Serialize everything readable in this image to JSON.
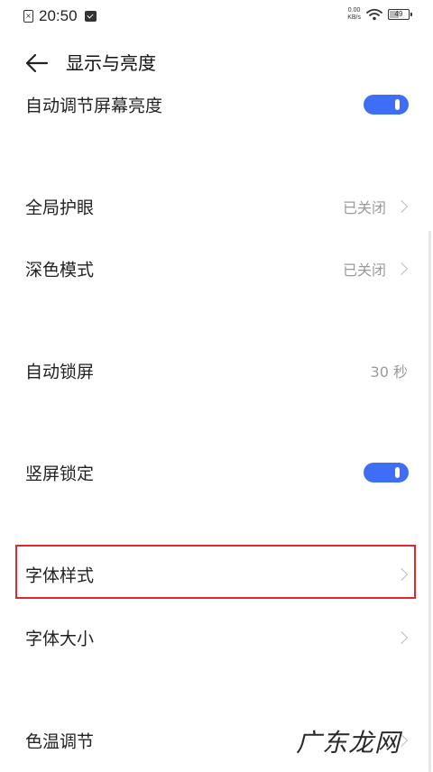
{
  "status_bar": {
    "time": "20:50",
    "net_speed_value": "0.00",
    "net_speed_unit": "KB/s",
    "battery": "49"
  },
  "header": {
    "title": "显示与亮度"
  },
  "settings": {
    "auto_brightness": {
      "label": "自动调节屏幕亮度",
      "on": true
    },
    "eye_care": {
      "label": "全局护眼",
      "value": "已关闭"
    },
    "dark_mode": {
      "label": "深色模式",
      "value": "已关闭"
    },
    "auto_lock": {
      "label": "自动锁屏",
      "value": "30 秒"
    },
    "portrait_lock": {
      "label": "竖屏锁定",
      "on": true
    },
    "font_style": {
      "label": "字体样式",
      "highlighted": true
    },
    "font_size": {
      "label": "字体大小"
    },
    "color_temp": {
      "label": "色温调节"
    }
  },
  "watermark": "广东龙网",
  "colors": {
    "toggle_on": "#3d6ef5",
    "highlight_border": "#e0292e",
    "secondary_text": "#9a9a9a"
  }
}
